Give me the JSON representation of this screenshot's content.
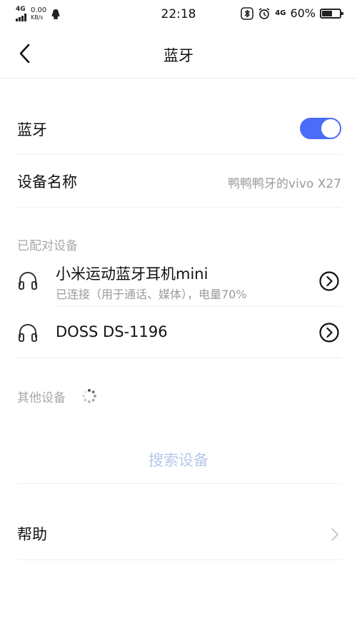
{
  "status_bar": {
    "network_left": "4G",
    "speed_value": "0.00",
    "speed_unit": "KB/s",
    "time": "22:18",
    "network_right": "4G",
    "battery_text": "60%",
    "battery_level": 0.6
  },
  "nav": {
    "title": "蓝牙",
    "back_icon": "chevron-left-icon"
  },
  "bluetooth": {
    "label": "蓝牙",
    "enabled": true,
    "accent": "#4a6cf7"
  },
  "device_name": {
    "label": "设备名称",
    "value": "鸭鸭鸭牙的vivo X27"
  },
  "paired": {
    "header": "已配对设备",
    "devices": [
      {
        "name": "小米运动蓝牙耳机mini",
        "status": "已连接（用于通话、媒体），电量70%",
        "icon": "headphones-icon",
        "action_icon": "chevron-circle-right-icon"
      },
      {
        "name": "DOSS DS-1196",
        "status": "",
        "icon": "headphones-icon",
        "action_icon": "chevron-circle-right-icon"
      }
    ]
  },
  "other": {
    "header": "其他设备",
    "search_label": "搜索设备",
    "search_color": "#b7c8ec"
  },
  "help": {
    "label": "帮助",
    "icon": "chevron-right-icon"
  }
}
